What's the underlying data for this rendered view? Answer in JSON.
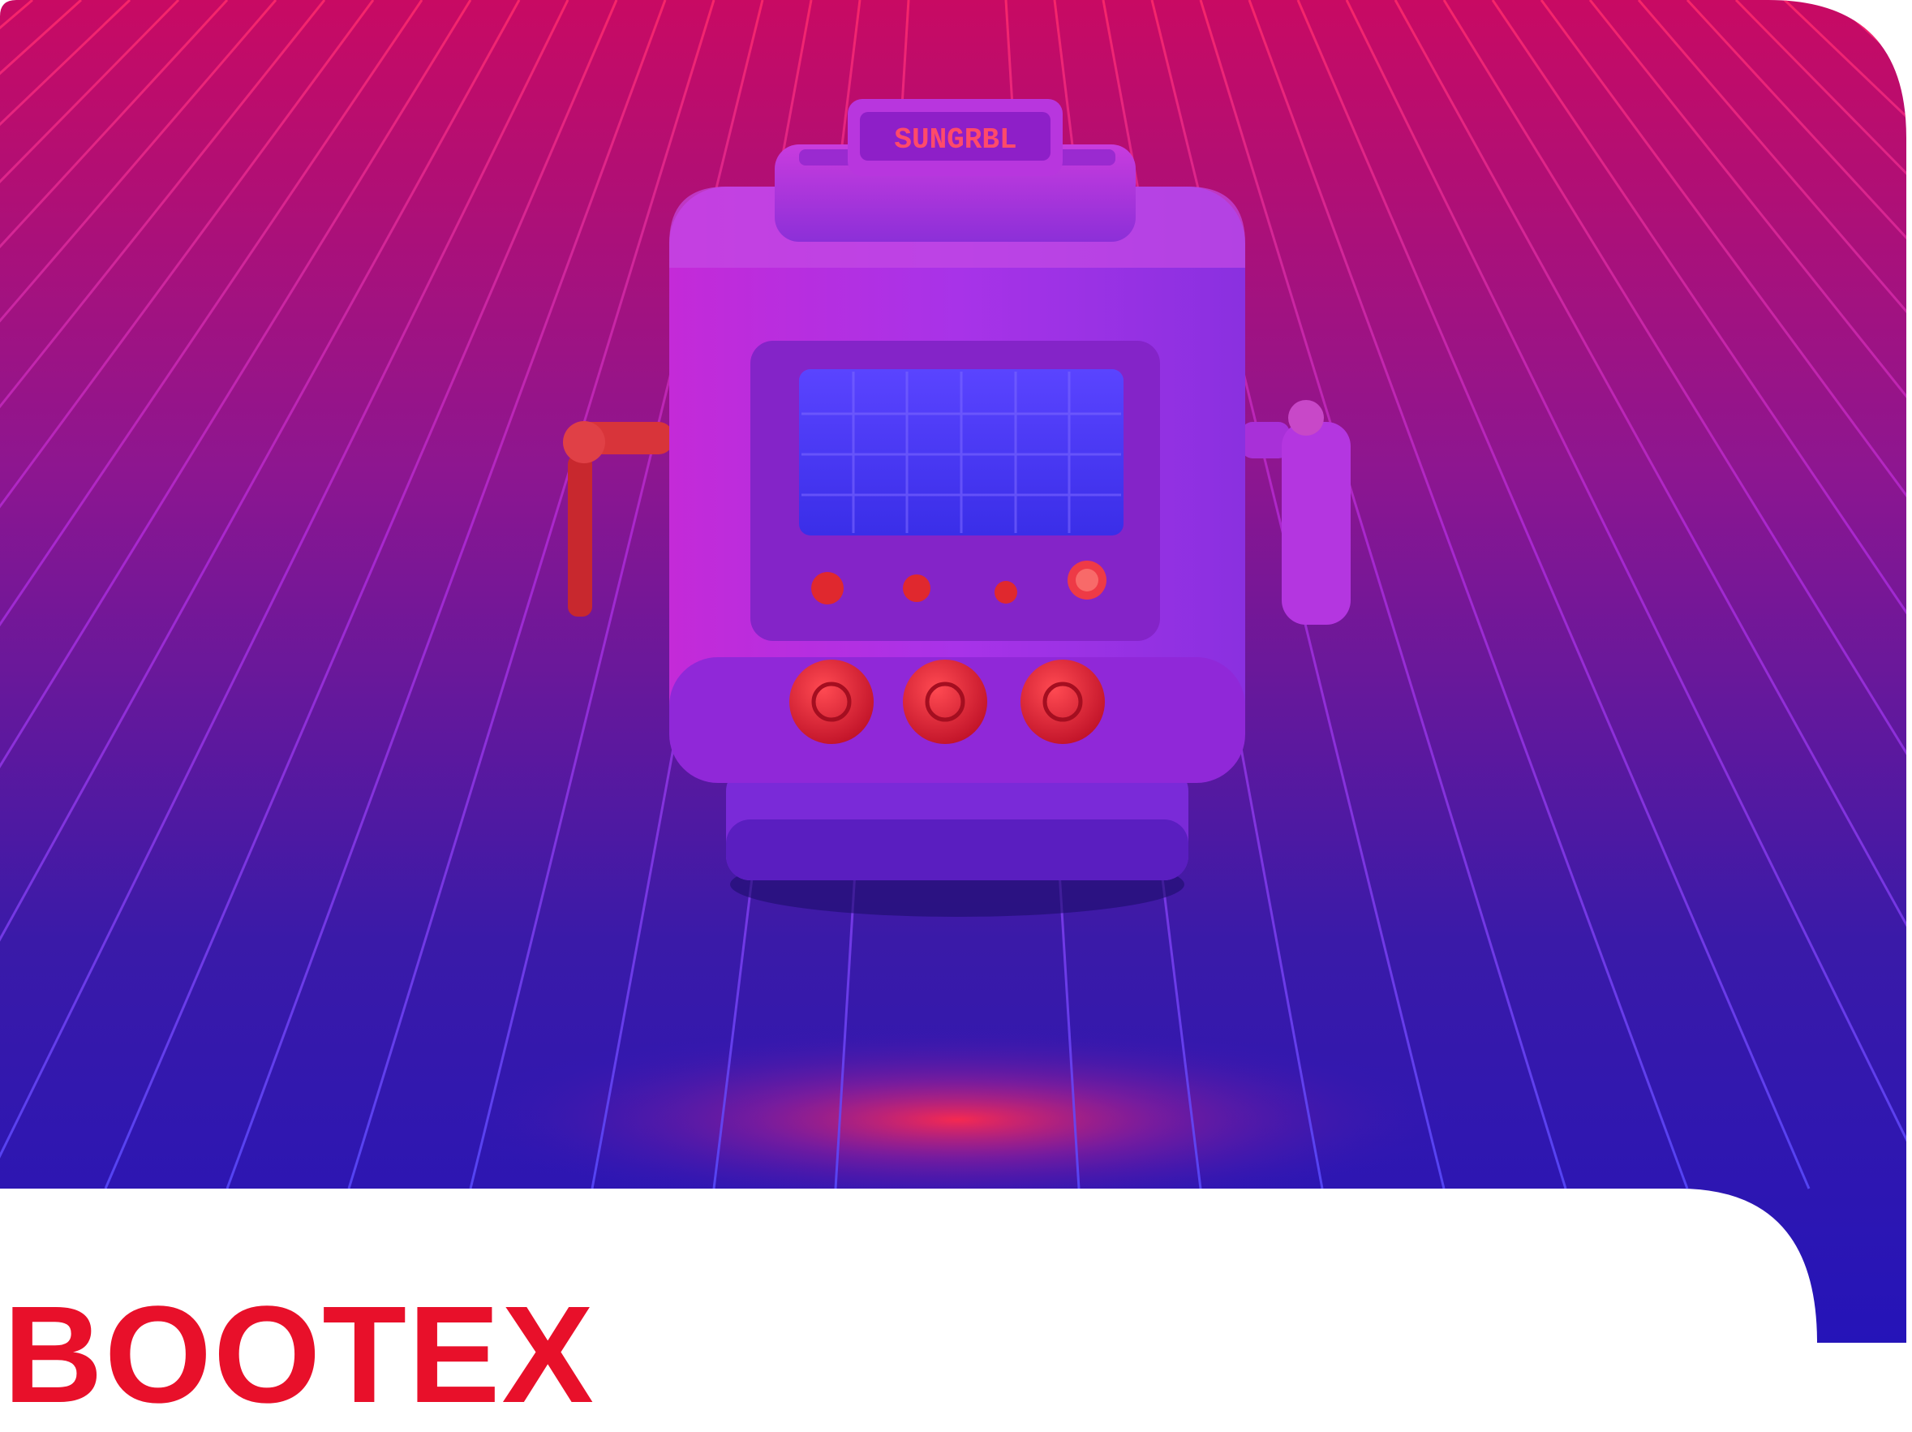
{
  "image": {
    "description_free": true,
    "machine_sign_text": "SUNGRBL",
    "brand_text": "BOOTEX"
  },
  "colors": {
    "brand_red": "#e8102a",
    "grid_top": "#d8105e",
    "grid_bottom": "#3b1bd0",
    "floor_glow": "#ff2450",
    "machine_purple": "#a52ee0",
    "screen_blue": "#4a3cff",
    "knob_red": "#e0202e"
  },
  "icons": [
    "machine-illustration",
    "left-lever-icon",
    "right-lever-icon",
    "screen-icon",
    "knob-icon"
  ]
}
